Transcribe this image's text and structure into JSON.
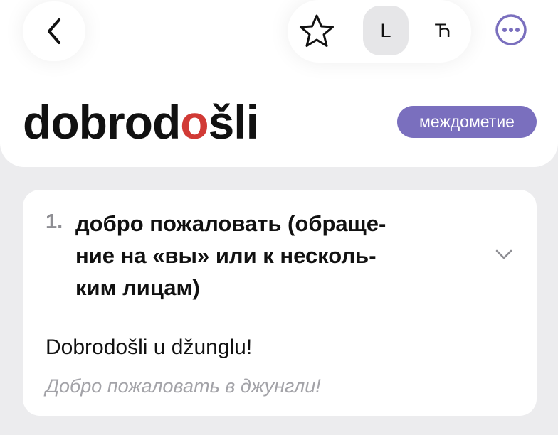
{
  "header": {
    "script_options": [
      "L",
      "Ћ"
    ],
    "selected_script": "L"
  },
  "word": {
    "before_stress": "dobrod",
    "stressed_letter": "o",
    "after_stress": "šli",
    "part_of_speech": "междометие"
  },
  "senses": [
    {
      "number": "1.",
      "definition": "добро пожаловать (обраще-\nние на «вы» или к несколь-\nким лицам)",
      "example": "Dobrodošli u džunglu!",
      "translation": "Добро пожаловать в джунгли!"
    }
  ],
  "colors": {
    "accent": "#7a6fbe",
    "stress": "#d13a35"
  }
}
